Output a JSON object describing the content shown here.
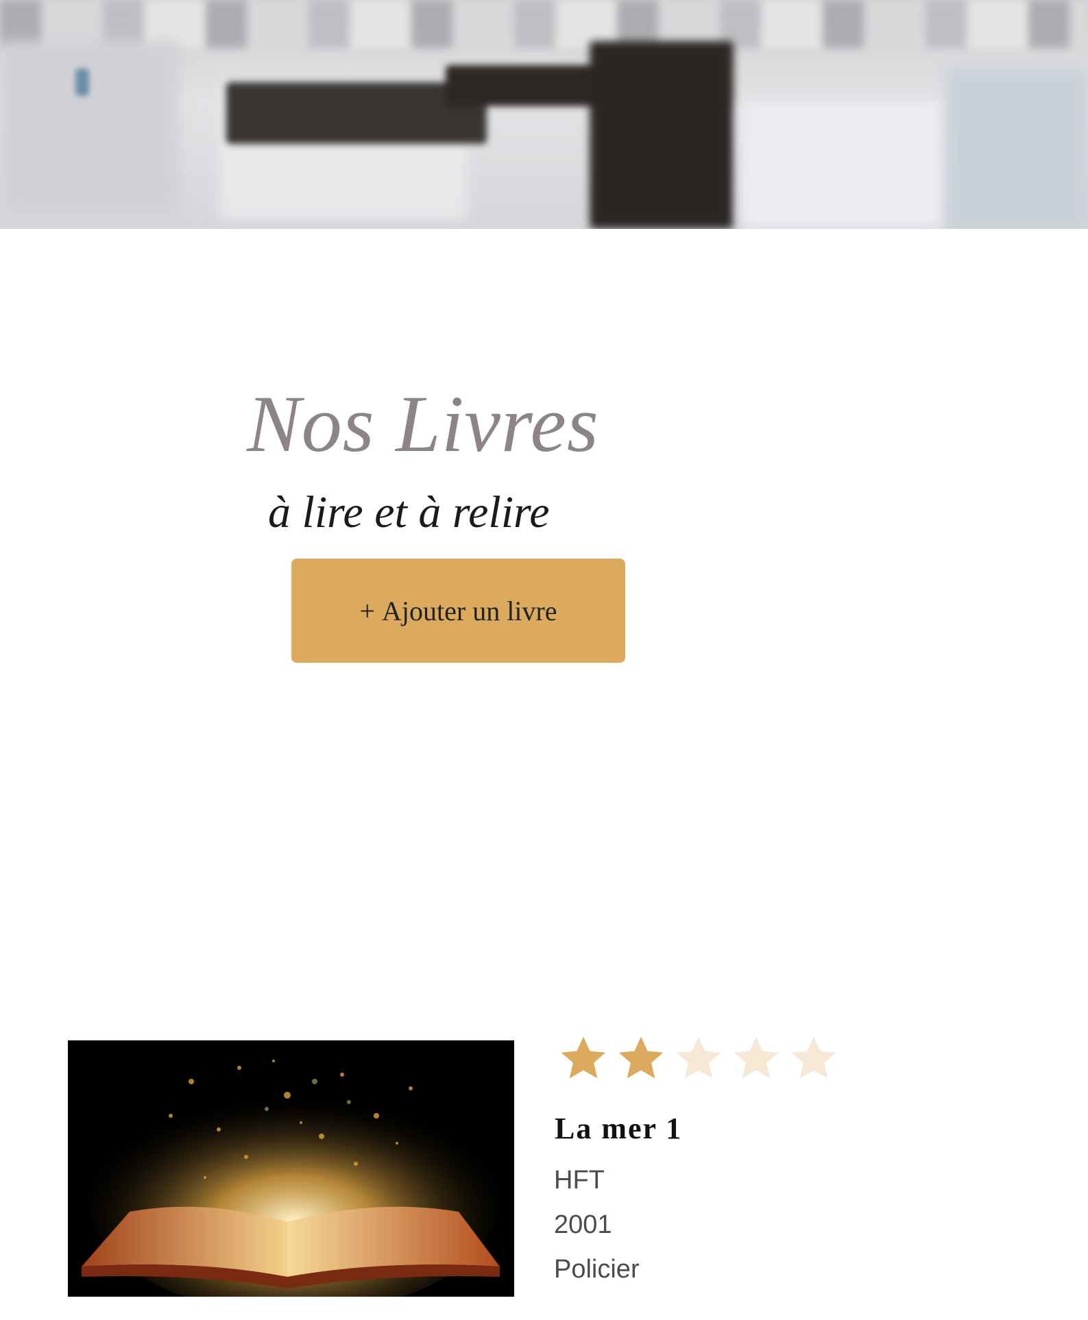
{
  "header": {
    "title": "Nos Livres",
    "subtitle": "à lire et à relire"
  },
  "actions": {
    "add_book_plus": "+",
    "add_book_label": "Ajouter un livre"
  },
  "colors": {
    "accent": "#dcaa5d",
    "title": "#8d8485",
    "star_filled": "#dcaa5d",
    "star_empty": "#f6e8d4"
  },
  "books": [
    {
      "rating": 2,
      "rating_max": 5,
      "title": "La mer 1",
      "author": "HFT",
      "year": "2001",
      "genre": "Policier",
      "cover_icon": "open-book-image"
    }
  ]
}
